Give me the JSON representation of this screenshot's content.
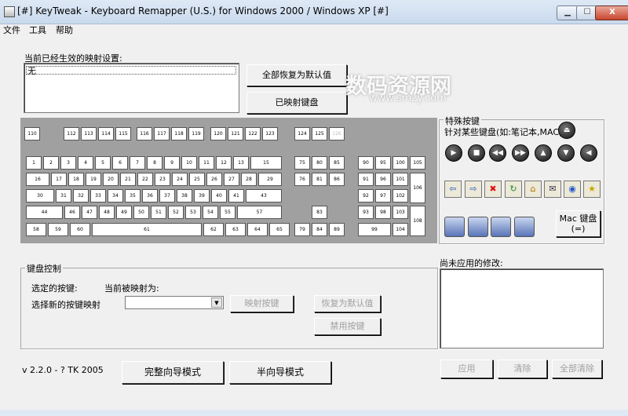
{
  "window": {
    "title": "[#] KeyTweak -  Keyboard Remapper (U.S.)  for Windows 2000 / Windows XP [#]",
    "minimize_glyph": "▁",
    "maximize_glyph": "☐",
    "close_glyph": "X"
  },
  "menu": [
    "文件",
    "工具",
    "帮助"
  ],
  "current_mappings": {
    "label": "当前已经生效的映射设置:",
    "content": "无"
  },
  "buttons": {
    "restore_all": "全部恢复为默认值",
    "show_mapped": "已映射键盘"
  },
  "keyboard": {
    "keys": [
      {
        "n": "110"
      },
      {
        "n": "112"
      },
      {
        "n": "113"
      },
      {
        "n": "114"
      },
      {
        "n": "115"
      },
      {
        "n": "116"
      },
      {
        "n": "117"
      },
      {
        "n": "118"
      },
      {
        "n": "119"
      },
      {
        "n": "120"
      },
      {
        "n": "121"
      },
      {
        "n": "122"
      },
      {
        "n": "123"
      },
      {
        "n": "124"
      },
      {
        "n": "125"
      },
      {
        "n": "126",
        "dim": true
      },
      {
        "n": "1"
      },
      {
        "n": "2"
      },
      {
        "n": "3"
      },
      {
        "n": "4"
      },
      {
        "n": "5"
      },
      {
        "n": "6"
      },
      {
        "n": "7"
      },
      {
        "n": "8"
      },
      {
        "n": "9"
      },
      {
        "n": "10"
      },
      {
        "n": "11"
      },
      {
        "n": "12"
      },
      {
        "n": "13"
      },
      {
        "n": "15"
      },
      {
        "n": "75"
      },
      {
        "n": "80"
      },
      {
        "n": "85"
      },
      {
        "n": "90"
      },
      {
        "n": "95"
      },
      {
        "n": "100"
      },
      {
        "n": "105"
      },
      {
        "n": "16"
      },
      {
        "n": "17"
      },
      {
        "n": "18"
      },
      {
        "n": "19"
      },
      {
        "n": "20"
      },
      {
        "n": "21"
      },
      {
        "n": "22"
      },
      {
        "n": "23"
      },
      {
        "n": "24"
      },
      {
        "n": "25"
      },
      {
        "n": "26"
      },
      {
        "n": "27"
      },
      {
        "n": "28"
      },
      {
        "n": "29"
      },
      {
        "n": "76"
      },
      {
        "n": "81"
      },
      {
        "n": "86"
      },
      {
        "n": "91"
      },
      {
        "n": "96"
      },
      {
        "n": "101"
      },
      {
        "n": "106"
      },
      {
        "n": "30"
      },
      {
        "n": "31"
      },
      {
        "n": "32"
      },
      {
        "n": "33"
      },
      {
        "n": "34"
      },
      {
        "n": "35"
      },
      {
        "n": "36"
      },
      {
        "n": "37"
      },
      {
        "n": "38"
      },
      {
        "n": "39"
      },
      {
        "n": "40"
      },
      {
        "n": "41"
      },
      {
        "n": "43"
      },
      {
        "n": "92"
      },
      {
        "n": "97"
      },
      {
        "n": "102"
      },
      {
        "n": "44"
      },
      {
        "n": "46"
      },
      {
        "n": "47"
      },
      {
        "n": "48"
      },
      {
        "n": "49"
      },
      {
        "n": "50"
      },
      {
        "n": "51"
      },
      {
        "n": "52"
      },
      {
        "n": "53"
      },
      {
        "n": "54"
      },
      {
        "n": "55"
      },
      {
        "n": "57"
      },
      {
        "n": "83"
      },
      {
        "n": "93"
      },
      {
        "n": "98"
      },
      {
        "n": "103"
      },
      {
        "n": "108"
      },
      {
        "n": "58"
      },
      {
        "n": "59"
      },
      {
        "n": "60"
      },
      {
        "n": "61"
      },
      {
        "n": "62"
      },
      {
        "n": "63"
      },
      {
        "n": "64"
      },
      {
        "n": "65"
      },
      {
        "n": "79"
      },
      {
        "n": "84"
      },
      {
        "n": "89"
      },
      {
        "n": "99"
      },
      {
        "n": "104"
      }
    ]
  },
  "special": {
    "title": "特殊按键",
    "subtitle": "针对某些键盘(如:笔记本,MAC)",
    "mac_button": "Mac 键盘\n(=)",
    "media_glyphs": [
      "⏏",
      "▶",
      "■",
      "◀◀",
      "▶▶",
      "▲",
      "▼",
      "◀"
    ],
    "nav_glyphs": [
      "⇦",
      "⇨",
      "✖",
      "↻",
      "⌂",
      "✉",
      "◉",
      "★"
    ]
  },
  "keyboard_control": {
    "title": "键盘控制",
    "selected_key": "选定的按键:",
    "current_mapping": "当前被映射为:",
    "choose_new": "选择新的按键映射",
    "combo_arrow": "▼",
    "map_key": "映射按键",
    "restore_default": "恢复为默认值",
    "disable_key": "禁用按键"
  },
  "pending": {
    "label": "尚未应用的修改:"
  },
  "bottom": {
    "version": "v 2.2.0 - ? TK 2005",
    "full_mode": "完整向导模式",
    "half_mode": "半向导模式",
    "apply": "应用",
    "clear": "清除",
    "clear_all": "全部清除"
  },
  "watermark": {
    "main": "数码资源网",
    "sub": "www.smzy.com"
  }
}
